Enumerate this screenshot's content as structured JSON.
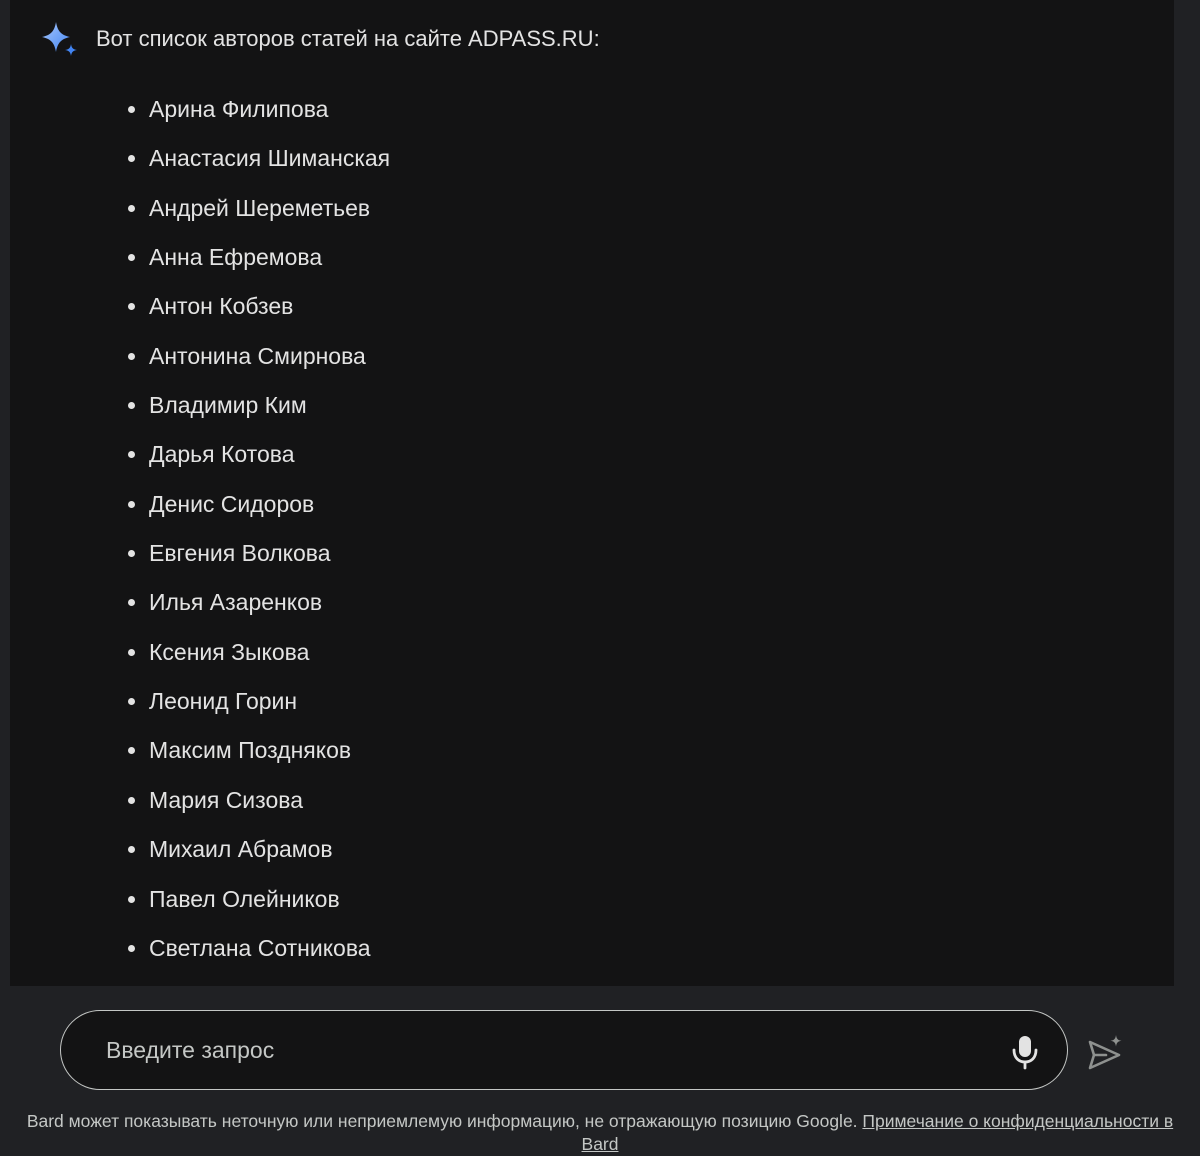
{
  "response": {
    "intro": "Вот список авторов статей на сайте ADPASS.RU:",
    "authors": [
      "Арина Филипова",
      "Анастасия Шиманская",
      "Андрей Шереметьев",
      "Анна Ефремова",
      "Антон Кобзев",
      "Антонина Смирнова",
      "Владимир Ким",
      "Дарья Котова",
      "Денис Сидоров",
      "Евгения Волкова",
      "Илья Азаренков",
      "Ксения Зыкова",
      "Леонид Горин",
      "Максим Поздняков",
      "Мария Сизова",
      "Михаил Абрамов",
      "Павел Олейников",
      "Светлана Сотникова"
    ]
  },
  "input": {
    "placeholder": "Введите запрос",
    "value": ""
  },
  "icons": {
    "assistant": "sparkle-icon",
    "mic": "microphone-icon",
    "send": "send-icon"
  },
  "footer": {
    "disclaimer": "Bard может показывать неточную или неприемлемую информацию, не отражающую позицию Google.",
    "privacy_link": "Примечание о конфиденциальности в Bard"
  },
  "colors": {
    "page_background": "#202124",
    "panel_background": "#131314",
    "text": "#e3e3e3",
    "muted_text": "#c4c7c5",
    "sparkle_start": "#4285f4",
    "sparkle_end": "#a8c7fa"
  }
}
